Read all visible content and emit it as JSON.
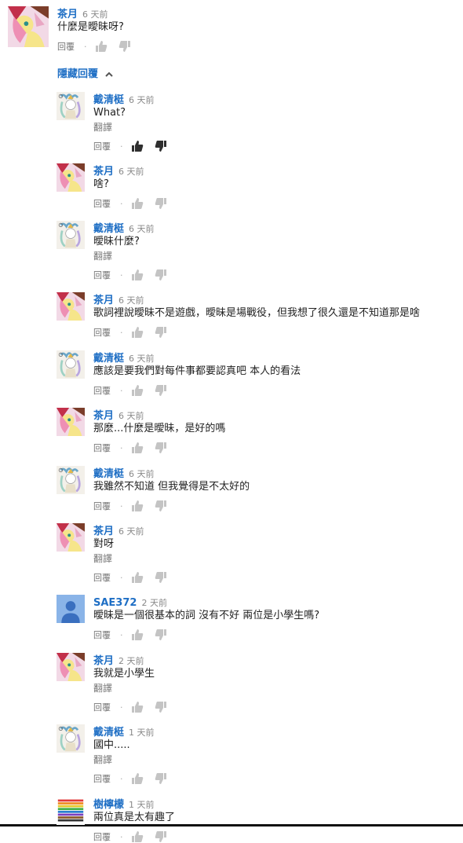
{
  "translate_label": "翻譯",
  "reply_label": "回覆",
  "separator": "·",
  "hide_replies_label": "隱藏回覆",
  "colors": {
    "author": "#1f6fc5",
    "liked_thumb": "#2f2f2f",
    "inactive_thumb": "#c4c4c4",
    "bottom_bar": "#111111"
  },
  "avatars": {
    "pony": "pony-avatar",
    "queen": "queen-avatar",
    "default": "default-user-avatar",
    "pencils": "colored-pencils-avatar"
  },
  "comments": [
    {
      "author": "茶月",
      "time": "6 天前",
      "text": "什麼是曖昧呀?",
      "avatar": "pony",
      "liked": false
    },
    {
      "author": "戴清梃",
      "time": "6 天前",
      "text": "What?",
      "avatar": "queen",
      "translate": true,
      "liked": true
    },
    {
      "author": "茶月",
      "time": "6 天前",
      "text": "啥?",
      "avatar": "pony",
      "liked": false
    },
    {
      "author": "戴清梃",
      "time": "6 天前",
      "text": "曖昧什麼?",
      "avatar": "queen",
      "translate": true,
      "liked": false
    },
    {
      "author": "茶月",
      "time": "6 天前",
      "text": "歌詞裡說曖昧不是遊戲，曖昧是場戰役，但我想了很久還是不知道那是啥",
      "avatar": "pony",
      "liked": false
    },
    {
      "author": "戴清梃",
      "time": "6 天前",
      "text": "應該是要我們對每件事都要認真吧 本人的看法",
      "avatar": "queen",
      "liked": false
    },
    {
      "author": "茶月",
      "time": "6 天前",
      "text": "那麼...什麼是曖昧，是好的嗎",
      "avatar": "pony",
      "liked": false
    },
    {
      "author": "戴清梃",
      "time": "6 天前",
      "text": "我雖然不知道 但我覺得是不太好的",
      "avatar": "queen",
      "liked": false
    },
    {
      "author": "茶月",
      "time": "6 天前",
      "text": "對呀",
      "avatar": "pony",
      "translate": true,
      "liked": false
    },
    {
      "author": "SAE372",
      "time": "2 天前",
      "text": "曖昧是一個很基本的詞 沒有不好 兩位是小學生嗎?",
      "avatar": "default",
      "liked": false
    },
    {
      "author": "茶月",
      "time": "2 天前",
      "text": "我就是小學生",
      "avatar": "pony",
      "translate": true,
      "liked": false
    },
    {
      "author": "戴清梃",
      "time": "1 天前",
      "text": "國中.....",
      "avatar": "queen",
      "translate": true,
      "liked": false
    },
    {
      "author": "樹檸檬",
      "time": "1 天前",
      "text": "兩位真是太有趣了",
      "avatar": "pencils",
      "liked": false
    }
  ]
}
